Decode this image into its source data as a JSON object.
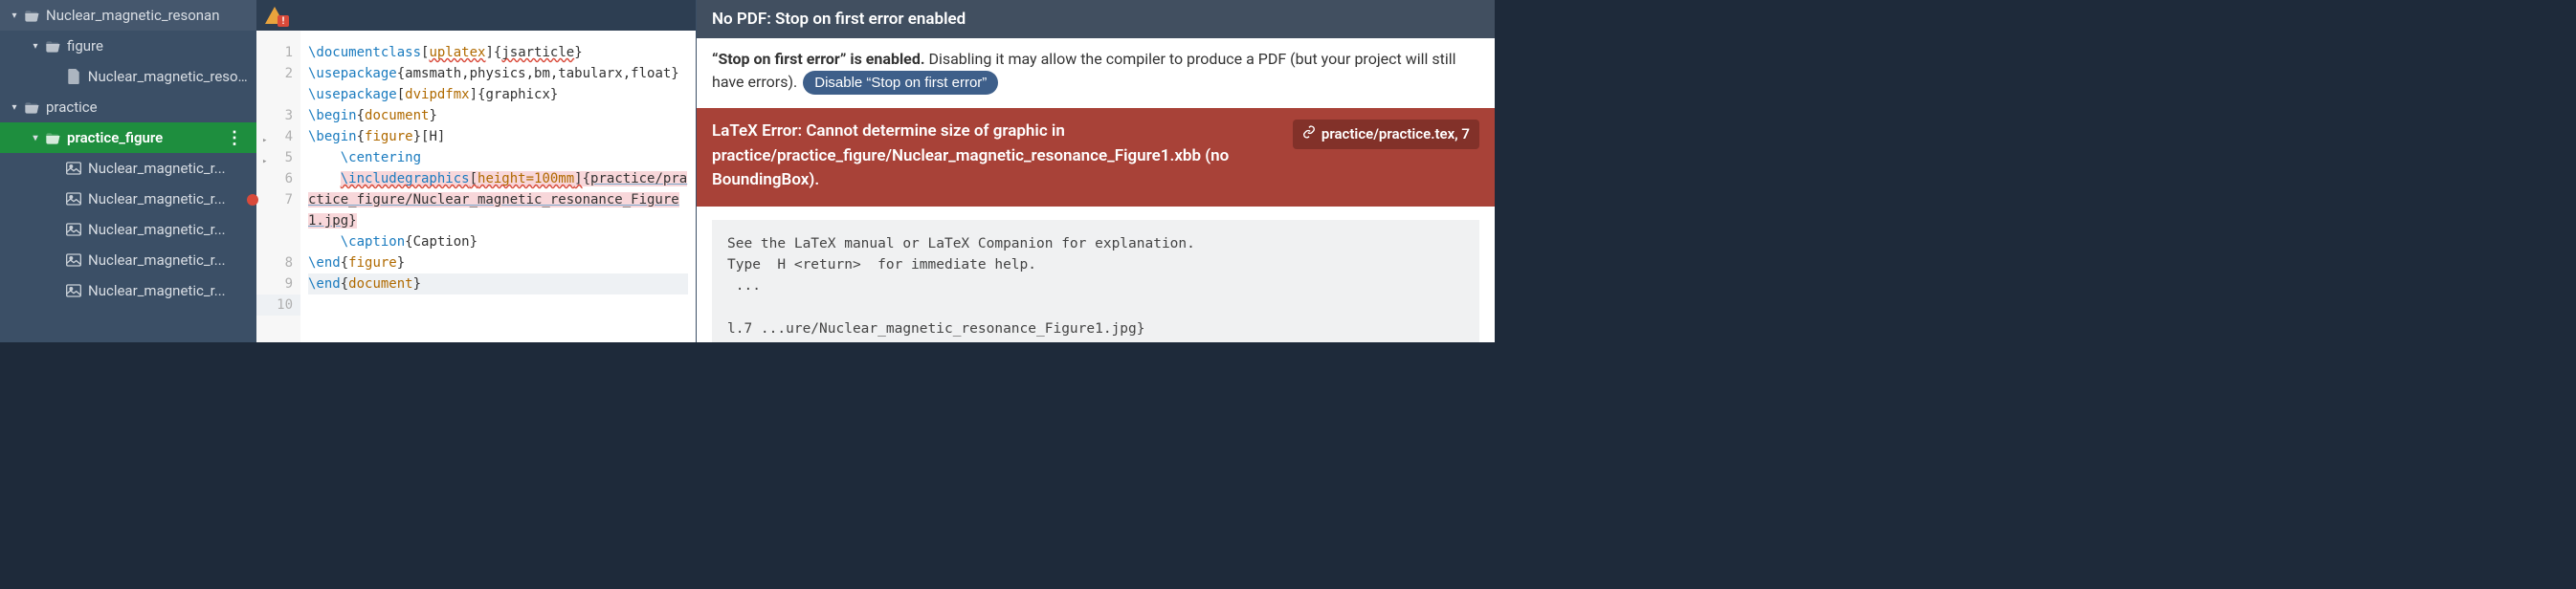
{
  "sidebar": {
    "items": [
      {
        "indent": 8,
        "chevron": "▾",
        "icon": "folder-open",
        "label": "Nuclear_magnetic_resonan"
      },
      {
        "indent": 30,
        "chevron": "▾",
        "icon": "folder-open",
        "label": "figure"
      },
      {
        "indent": 52,
        "chevron": "",
        "icon": "file",
        "label": "Nuclear_magnetic_reso..."
      },
      {
        "indent": 8,
        "chevron": "▾",
        "icon": "folder-open",
        "label": "practice"
      },
      {
        "indent": 30,
        "chevron": "▾",
        "icon": "folder-open",
        "label": "practice_figure",
        "selected": true,
        "actions": true
      },
      {
        "indent": 52,
        "chevron": "",
        "icon": "image",
        "label": "Nuclear_magnetic_r..."
      },
      {
        "indent": 52,
        "chevron": "",
        "icon": "image",
        "label": "Nuclear_magnetic_r..."
      },
      {
        "indent": 52,
        "chevron": "",
        "icon": "image",
        "label": "Nuclear_magnetic_r..."
      },
      {
        "indent": 52,
        "chevron": "",
        "icon": "image",
        "label": "Nuclear_magnetic_r..."
      },
      {
        "indent": 52,
        "chevron": "",
        "icon": "image",
        "label": "Nuclear_magnetic_r..."
      }
    ]
  },
  "editor": {
    "lines": [
      {
        "n": 1,
        "segs": [
          {
            "t": "\\documentclass",
            "c": "tok-cmd"
          },
          {
            "t": "[",
            "c": ""
          },
          {
            "t": "uplatex",
            "c": "tok-opt spell-wavy"
          },
          {
            "t": "]",
            "c": ""
          },
          {
            "t": "{",
            "c": ""
          },
          {
            "t": "jsarticle",
            "c": "spell-wavy"
          },
          {
            "t": "}",
            "c": ""
          }
        ]
      },
      {
        "n": 2,
        "wrap": 2,
        "segs": [
          {
            "t": "\\usepackage",
            "c": "tok-cmd"
          },
          {
            "t": "{",
            "c": ""
          },
          {
            "t": "amsmath,physics,bm,tabularx,float}",
            "c": ""
          }
        ]
      },
      {
        "n": 3,
        "segs": [
          {
            "t": "\\usepackage",
            "c": "tok-cmd"
          },
          {
            "t": "[",
            "c": ""
          },
          {
            "t": "dvipdfmx",
            "c": "tok-opt"
          },
          {
            "t": "]",
            "c": ""
          },
          {
            "t": "{graphicx}",
            "c": ""
          }
        ]
      },
      {
        "n": 4,
        "fold": true,
        "segs": [
          {
            "t": "\\begin",
            "c": "tok-cmd"
          },
          {
            "t": "{",
            "c": ""
          },
          {
            "t": "document",
            "c": "tok-opt"
          },
          {
            "t": "}",
            "c": ""
          }
        ]
      },
      {
        "n": 5,
        "fold": true,
        "segs": [
          {
            "t": "\\begin",
            "c": "tok-cmd"
          },
          {
            "t": "{",
            "c": ""
          },
          {
            "t": "figure",
            "c": "tok-opt"
          },
          {
            "t": "}[H]",
            "c": ""
          }
        ]
      },
      {
        "n": 6,
        "segs": [
          {
            "t": "    ",
            "c": ""
          },
          {
            "t": "\\centering",
            "c": "tok-cmd"
          }
        ]
      },
      {
        "n": 7,
        "err": true,
        "wrap": 3,
        "segs": [
          {
            "t": "    ",
            "c": ""
          },
          {
            "t": "\\includegraphics",
            "c": "tok-cmd err-highlight spell-wavy"
          },
          {
            "t": "[",
            "c": "err-highlight spell-wavy"
          },
          {
            "t": "height=100mm",
            "c": "tok-opt err-highlight spell-wavy"
          },
          {
            "t": "]",
            "c": "err-highlight spell-wavy"
          },
          {
            "t": "{",
            "c": "err-highlight"
          },
          {
            "t": "practice/practice_figure/Nuclear_magnetic_resonance_Figure1.jpg",
            "c": "err-highlight link-underline"
          },
          {
            "t": "}",
            "c": "err-highlight"
          }
        ]
      },
      {
        "n": 8,
        "segs": [
          {
            "t": "    ",
            "c": ""
          },
          {
            "t": "\\caption",
            "c": "tok-cmd"
          },
          {
            "t": "{Caption}",
            "c": ""
          }
        ]
      },
      {
        "n": 9,
        "segs": [
          {
            "t": "\\end",
            "c": "tok-cmd"
          },
          {
            "t": "{",
            "c": ""
          },
          {
            "t": "figure",
            "c": "tok-opt"
          },
          {
            "t": "}",
            "c": ""
          }
        ]
      },
      {
        "n": 10,
        "active": true,
        "segs": [
          {
            "t": "\\end",
            "c": "tok-cmd"
          },
          {
            "t": "{",
            "c": ""
          },
          {
            "t": "document",
            "c": "tok-opt"
          },
          {
            "t": "}",
            "c": ""
          }
        ]
      }
    ]
  },
  "right": {
    "header": "No PDF: Stop on first error enabled",
    "info_bold": "“Stop on first error” is enabled.",
    "info_rest": " Disabling it may allow the compiler to produce a PDF (but your project will still have errors). ",
    "disable_btn": "Disable “Stop on first error”",
    "error_msg": "LaTeX Error: Cannot determine size of graphic in practice/practice_figure/Nuclear_magnetic_resonance_Figure1.xbb (no BoundingBox).",
    "error_link": "practice/practice.tex, 7",
    "terminal": "See the LaTeX manual or LaTeX Companion for explanation.\nType  H <return>  for immediate help.\n ...\n\nl.7 ...ure/Nuclear_magnetic_resonance_Figure1.jpg}"
  }
}
